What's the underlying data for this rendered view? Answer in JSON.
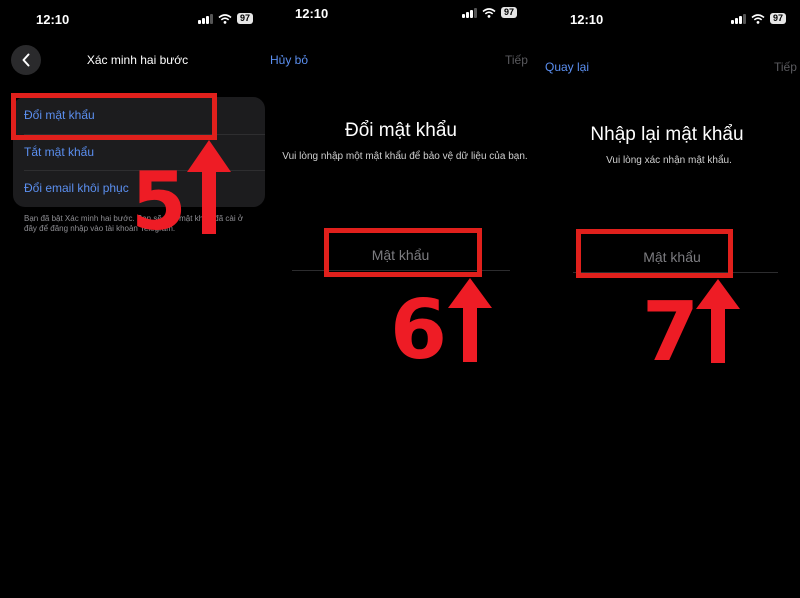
{
  "status_bar": {
    "time": "12:10",
    "battery": "97"
  },
  "screen1": {
    "title": "Xác minh hai bước",
    "menu": [
      "Đổi mật khẩu",
      "Tắt mật khẩu",
      "Đổi email khôi phục"
    ],
    "footnote": "Bạn đã bật Xác minh hai bước. Bạn sẽ cần mật khẩu đã cài ở đây để đăng nhập vào tài khoản Telegram."
  },
  "screen2": {
    "cancel": "Hủy bỏ",
    "next": "Tiếp",
    "title": "Đổi mật khẩu",
    "subtitle": "Vui lòng nhập một mật khẩu để bảo vệ dữ liệu của bạn.",
    "placeholder": "Mật khẩu"
  },
  "screen3": {
    "back": "Quay lại",
    "next": "Tiếp",
    "title": "Nhập lại mật khẩu",
    "subtitle": "Vui lòng xác nhận mật khẩu.",
    "placeholder": "Mật khẩu"
  },
  "annotations": {
    "step5": "5",
    "step6": "6",
    "step7": "7"
  },
  "colors": {
    "background": "#000000",
    "accent": "#5b8ff0",
    "highlight": "#e0201c",
    "card": "#1c1c1e"
  }
}
